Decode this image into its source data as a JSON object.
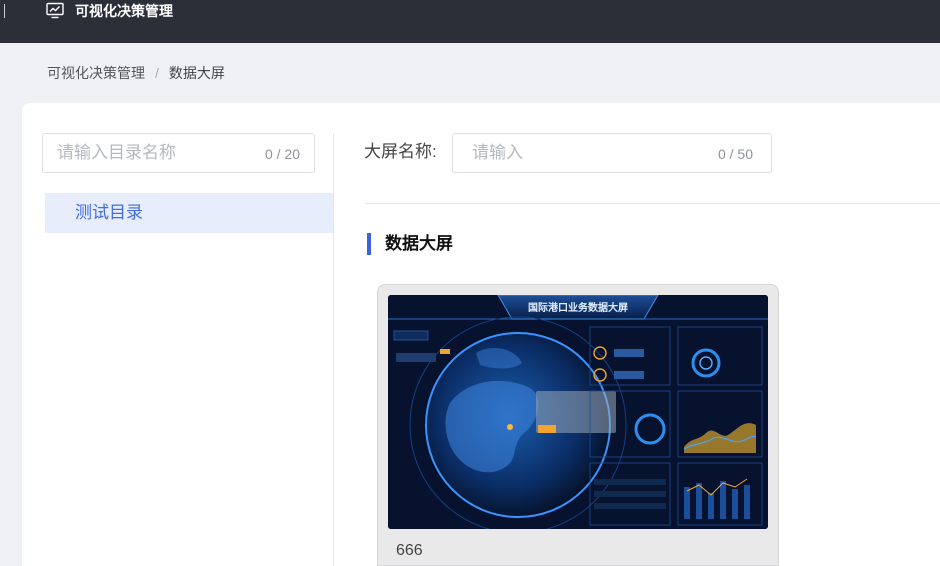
{
  "app": {
    "title": "可视化决策管理",
    "icon": "chart-monitor-icon"
  },
  "breadcrumb": {
    "items": [
      "可视化决策管理",
      "数据大屏"
    ],
    "separator": "/"
  },
  "directory": {
    "search": {
      "placeholder": "请输入目录名称",
      "count": "0 / 20"
    },
    "items": [
      {
        "label": "测试目录",
        "selected": true
      }
    ]
  },
  "filter": {
    "label": "大屏名称:",
    "placeholder": "请输入",
    "count": "0 / 50"
  },
  "section": {
    "title": "数据大屏"
  },
  "cards": [
    {
      "name": "666",
      "preview_title": "国际港口业务数据大屏"
    }
  ],
  "colors": {
    "accent": "#3b63dd",
    "topbar": "#2b2f38",
    "selected_bg": "#e8edfb",
    "selected_text": "#3f6ee0"
  }
}
